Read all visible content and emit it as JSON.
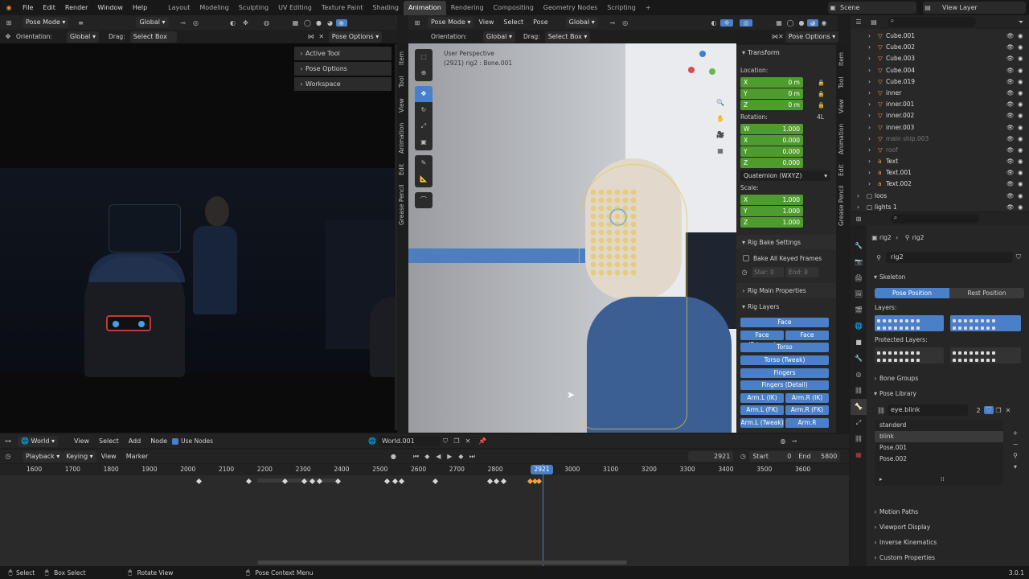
{
  "topmenu": {
    "items": [
      "File",
      "Edit",
      "Render",
      "Window",
      "Help"
    ],
    "workspaces": [
      "Layout",
      "Modeling",
      "Sculpting",
      "UV Editing",
      "Texture Paint",
      "Shading",
      "Animation",
      "Rendering",
      "Compositing",
      "Geometry Nodes",
      "Scripting"
    ],
    "active_workspace": "Animation",
    "add_tab": "+",
    "scene": "Scene",
    "view_layer": "View Layer"
  },
  "leftview": {
    "mode": "Pose Mode",
    "transform": "Global",
    "orientation_label": "Orientation:",
    "orientation_value": "Global",
    "drag_label": "Drag:",
    "drag_value": "Select Box",
    "pose_options": "Pose Options",
    "panels": [
      "Active Tool",
      "Pose Options",
      "Workspace"
    ],
    "tabs": [
      "Item",
      "Tool",
      "View",
      "Animation",
      "Edit",
      "Grease Pencil"
    ]
  },
  "rightview": {
    "mode": "Pose Mode",
    "menus": [
      "View",
      "Select",
      "Pose"
    ],
    "transform": "Global",
    "orientation_label": "Orientation:",
    "orientation_value": "Global",
    "drag_label": "Drag:",
    "drag_value": "Select Box",
    "pose_options": "Pose Options",
    "overlay_title": "User Perspective",
    "overlay_sub": "(2921) rig2 : Bone.001",
    "tabs": [
      "Item",
      "Tool",
      "View",
      "Animation",
      "Edit",
      "Grease Pencil"
    ]
  },
  "npanel": {
    "transform": "Transform",
    "location": "Location:",
    "loc": [
      {
        "axis": "X",
        "val": "0 m"
      },
      {
        "axis": "Y",
        "val": "0 m"
      },
      {
        "axis": "Z",
        "val": "0 m"
      }
    ],
    "rotation": "Rotation:",
    "rot_mode_tag": "4L",
    "rot": [
      {
        "axis": "W",
        "val": "1.000"
      },
      {
        "axis": "X",
        "val": "0.000"
      },
      {
        "axis": "Y",
        "val": "0.000"
      },
      {
        "axis": "Z",
        "val": "0.000"
      }
    ],
    "rot_mode": "Quaternion (WXYZ)",
    "scale": "Scale:",
    "scl": [
      {
        "axis": "X",
        "val": "1.000"
      },
      {
        "axis": "Y",
        "val": "1.000"
      },
      {
        "axis": "Z",
        "val": "1.000"
      }
    ],
    "bake_settings": "Rig Bake Settings",
    "bake_all": "Bake All Keyed Frames",
    "start": "Star: 0",
    "end": "End: 0",
    "main_props": "Rig Main Properties",
    "rig_layers": "Rig Layers",
    "layers": {
      "face": "Face",
      "face_primary": "Face (Primary)",
      "face_second": "Face (Second...",
      "torso": "Torso",
      "torso_tweak": "Torso (Tweak)",
      "fingers": "Fingers",
      "fingers_detail": "Fingers (Detail)",
      "arm_l_ik": "Arm.L (IK)",
      "arm_r_ik": "Arm.R (IK)",
      "arm_l_fk": "Arm.L (FK)",
      "arm_r_fk": "Arm.R (FK)",
      "arm_l_tw": "Arm.L (Tweak)",
      "arm_r_tw": "Arm.R (Tweak)"
    }
  },
  "outliner": {
    "items": [
      "Cube.001",
      "Cube.002",
      "Cube.003",
      "Cube.004",
      "Cube.019",
      "inner",
      "inner.001",
      "inner.002",
      "inner.003",
      "main ship.003",
      "roof",
      "Text",
      "Text.001",
      "Text.002",
      "loos",
      "lights 1"
    ]
  },
  "props": {
    "crumb1": "rig2",
    "crumb2": "rig2",
    "data_name": "rig2",
    "skeleton": "Skeleton",
    "pose_position": "Pose Position",
    "rest_position": "Rest Position",
    "layers_lbl": "Layers:",
    "protected_lbl": "Protected Layers:",
    "bone_groups": "Bone Groups",
    "pose_library": "Pose Library",
    "library_name": "eye.blink",
    "library_users": "2",
    "poses": [
      "standerd",
      "blink",
      "Pose.001",
      "Pose.002"
    ],
    "sections": [
      "Motion Paths",
      "Viewport Display",
      "Inverse Kinematics",
      "Custom Properties"
    ]
  },
  "nodebar": {
    "world": "World",
    "menus": [
      "View",
      "Select",
      "Add",
      "Node"
    ],
    "use_nodes": "Use Nodes",
    "world_name": "World.001"
  },
  "timeline": {
    "menus": [
      "Playback",
      "Keying",
      "View",
      "Marker"
    ],
    "current": "2921",
    "start_label": "Start",
    "start": "0",
    "end_label": "End",
    "end": "5800",
    "ticks": [
      "1600",
      "1700",
      "1800",
      "1900",
      "2000",
      "2100",
      "2200",
      "2300",
      "2400",
      "2500",
      "2600",
      "2700",
      "2800",
      "2921",
      "3000",
      "3100",
      "3200",
      "3300",
      "3400",
      "3500",
      "3600"
    ]
  },
  "status": {
    "select": "Select",
    "box_select": "Box Select",
    "rotate_view": "Rotate View",
    "context_menu": "Pose Context Menu",
    "version": "3.0.1"
  }
}
